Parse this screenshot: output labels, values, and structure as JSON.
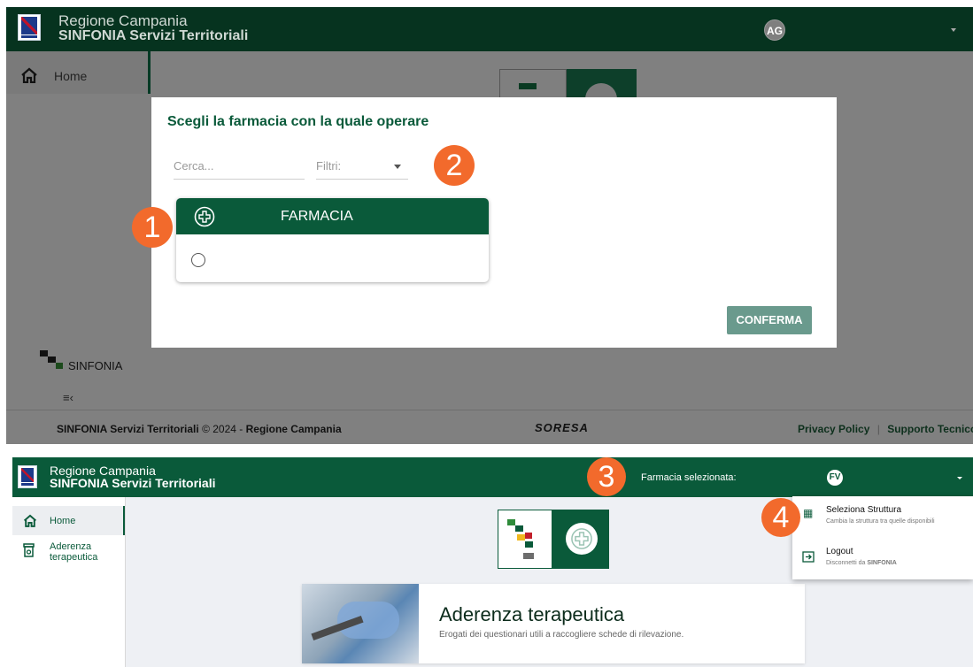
{
  "panel1": {
    "header": {
      "region": "Regione Campania",
      "app_name": "SINFONIA Servizi Territoriali",
      "avatar_initials": "AG"
    },
    "sidebar": {
      "home_label": "Home",
      "brand_label": "SINFONIA"
    },
    "dialog": {
      "title": "Scegli la farmacia con la quale operare",
      "search_placeholder": "Cerca...",
      "filter_label": "Filtri:",
      "card_header": "FARMACIA",
      "confirm_label": "CONFERMA"
    },
    "footer": {
      "app_name": "SINFONIA Servizi Territoriali",
      "copyright": "© 2024 -",
      "region": "Regione Campania",
      "soresa_logo": "SORESA",
      "privacy": "Privacy Policy",
      "separator": "|",
      "support": "Supporto Tecnico"
    }
  },
  "panel2": {
    "header": {
      "region": "Regione Campania",
      "app_name": "SINFONIA Servizi Territoriali",
      "selected_label": "Farmacia selezionata:",
      "avatar_initials": "FV"
    },
    "sidebar": {
      "items": [
        {
          "label": "Home",
          "icon": "home-icon"
        },
        {
          "label": "Aderenza terapeutica",
          "icon": "pill-bottle-icon"
        }
      ]
    },
    "menu": {
      "items": [
        {
          "title": "Seleziona Struttura",
          "subtitle": "Cambia la struttura tra quelle disponibili",
          "icon": "building-icon"
        },
        {
          "title": "Logout",
          "subtitle_prefix": "Disconnetti da",
          "subtitle_brand": "SINFONIA",
          "icon": "logout-icon"
        }
      ]
    },
    "card": {
      "title": "Aderenza terapeutica",
      "subtitle": "Erogati dei questionari utili a raccogliere schede di rilevazione."
    }
  },
  "annotations": [
    "1",
    "2",
    "3",
    "4"
  ],
  "colors": {
    "primary": "#0a5a3a",
    "confirm": "#6a9a8d",
    "badge": "#f26a2c",
    "overlay": "#808080"
  }
}
